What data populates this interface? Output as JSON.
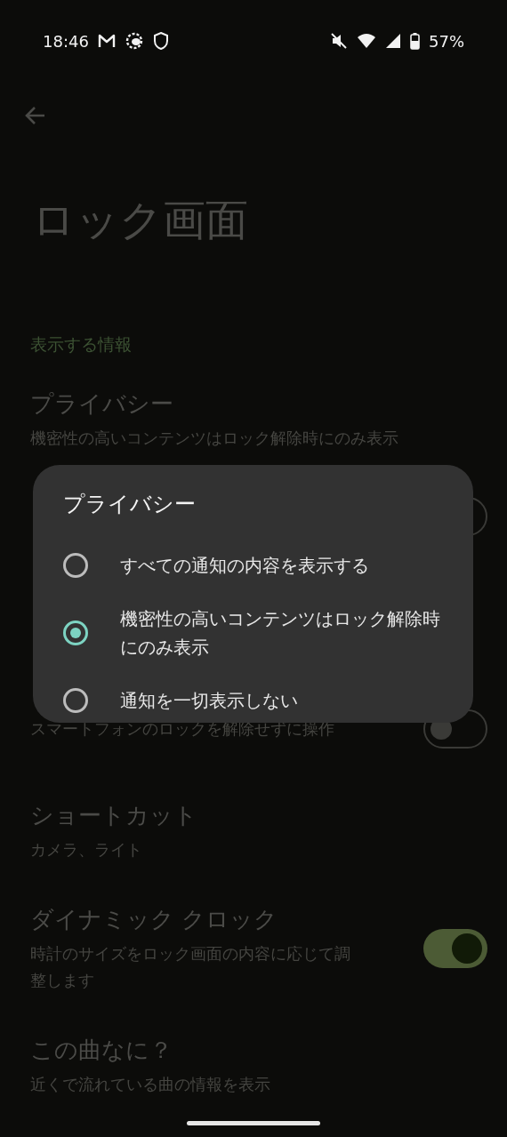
{
  "status_bar": {
    "time": "18:46",
    "battery": "57%"
  },
  "page": {
    "title": "ロック画面",
    "section": "表示する情報"
  },
  "rows": [
    {
      "kind": "text",
      "title": "プライバシー",
      "subtitle": "機密性の高いコンテンツはロック解除時にのみ表示"
    },
    {
      "kind": "toggle",
      "on": false
    },
    {
      "kind": "blank"
    },
    {
      "kind": "toggle",
      "subtitle": "スマートフォンのロックを解除せずに操作",
      "on": false
    },
    {
      "kind": "text",
      "title": "ショートカット",
      "subtitle": "カメラ、ライト"
    },
    {
      "kind": "toggle",
      "title": "ダイナミック クロック",
      "subtitle": "時計のサイズをロック画面の内容に応じて調整します",
      "on": true
    },
    {
      "kind": "text",
      "title": "この曲なに？",
      "subtitle": "近くで流れている曲の情報を表示"
    }
  ],
  "dialog": {
    "title": "プライバシー",
    "options": [
      {
        "label": "すべての通知の内容を表示する",
        "selected": false
      },
      {
        "label": "機密性の高いコンテンツはロック解除時にのみ表示",
        "selected": true
      },
      {
        "label": "通知を一切表示しない",
        "selected": false
      }
    ]
  }
}
